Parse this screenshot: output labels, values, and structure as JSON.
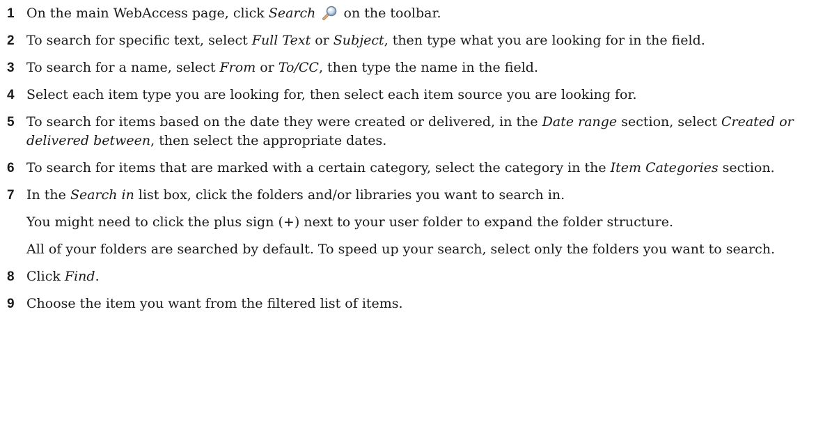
{
  "steps": [
    {
      "number": "1",
      "t0": "On the main WebAccess page, click ",
      "i0": "Search",
      "t1": " on the toolbar."
    },
    {
      "number": "2",
      "t0": "To search for specific text, select ",
      "i0": "Full Text",
      "t1": " or ",
      "i1": "Subject",
      "t2": ", then type what you are looking for in the field."
    },
    {
      "number": "3",
      "t0": "To search for a name, select ",
      "i0": "From",
      "t1": " or ",
      "i1": "To/CC",
      "t2": ", then type the name in the field."
    },
    {
      "number": "4",
      "t0": "Select each item type you are looking for, then select each item source you are looking for."
    },
    {
      "number": "5",
      "t0": "To search for items based on the date they were created or delivered, in the ",
      "i0": "Date range",
      "t1": " section, select ",
      "i1": "Created or delivered between",
      "t2": ", then select the appropriate dates."
    },
    {
      "number": "6",
      "t0": "To search for items that are marked with a certain category, select the category in the ",
      "i0": "Item Categories",
      "t1": " section."
    },
    {
      "number": "7",
      "t0": "In the ",
      "i0": "Search in",
      "t1": " list box, click the folders and/or libraries you want to search in.",
      "note1": "You might need to click the plus sign (+) next to your user folder to expand the folder structure.",
      "note2": "All of your folders are searched by default. To speed up your search, select only the folders you want to search."
    },
    {
      "number": "8",
      "t0": "Click ",
      "i0": "Find",
      "t1": "."
    },
    {
      "number": "9",
      "t0": "Choose the item you want from the filtered list of items."
    }
  ],
  "icons": {
    "search": "search-icon"
  }
}
